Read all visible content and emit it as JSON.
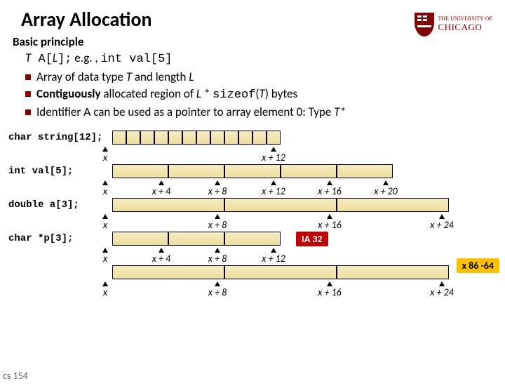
{
  "title": "Array Allocation",
  "logo": {
    "line1": "THE UNIVERSITY OF",
    "line2": "CHICAGO"
  },
  "content": {
    "subhead": "Basic principle",
    "decl_T": "T",
    "decl_code1": " A[",
    "decl_L": "L",
    "decl_code2": "];",
    "decl_eg": "  e.g. , ",
    "decl_eg_code": "int val[5]",
    "bullet1_a": "Array of data type ",
    "bullet1_T": "T",
    "bullet1_b": " and length ",
    "bullet1_L": "L",
    "bullet2_a": "Contiguously",
    "bullet2_b": " allocated region of ",
    "bullet2_L": "L",
    "bullet2_c": " * ",
    "bullet2_code": "sizeof",
    "bullet2_d": "(",
    "bullet2_T": "T",
    "bullet2_e": ") bytes",
    "bullet3_a": "Identifier ",
    "bullet3_code": "A",
    "bullet3_b": " can be used as a pointer to array element 0: Type ",
    "bullet3_T": "T*"
  },
  "diagrams": {
    "d1": {
      "label": "char string[12];",
      "ticks": [
        {
          "pos": 0,
          "text": "x"
        },
        {
          "pos": 240,
          "text": "x + 12"
        }
      ]
    },
    "d2": {
      "label": "int val[5];",
      "ticks": [
        {
          "pos": 0,
          "text": "x"
        },
        {
          "pos": 80,
          "text": "x + 4"
        },
        {
          "pos": 160,
          "text": "x + 8"
        },
        {
          "pos": 240,
          "text": "x + 12"
        },
        {
          "pos": 320,
          "text": "x + 16"
        },
        {
          "pos": 400,
          "text": "x + 20"
        }
      ]
    },
    "d3": {
      "label": "double a[3];",
      "ticks": [
        {
          "pos": 0,
          "text": "x"
        },
        {
          "pos": 160,
          "text": "x + 8"
        },
        {
          "pos": 320,
          "text": "x + 16"
        },
        {
          "pos": 480,
          "text": "x + 24"
        }
      ]
    },
    "d4": {
      "label": "char *p[3];",
      "ticks": [
        {
          "pos": 0,
          "text": "x"
        },
        {
          "pos": 80,
          "text": "x + 4"
        },
        {
          "pos": 160,
          "text": "x + 8"
        },
        {
          "pos": 240,
          "text": "x + 12"
        }
      ]
    },
    "d5": {
      "ticks": [
        {
          "pos": 0,
          "text": "x"
        },
        {
          "pos": 160,
          "text": "x + 8"
        },
        {
          "pos": 320,
          "text": "x + 16"
        },
        {
          "pos": 480,
          "text": "x + 24"
        }
      ]
    }
  },
  "badges": {
    "ia32": "IA 32",
    "x8664": "x 86 -64"
  },
  "footer": "cs 154",
  "chart_data": [
    {
      "type": "table",
      "title": "char string[12]",
      "element_bytes": 1,
      "count": 12,
      "addresses_labeled": [
        "x",
        "x+12"
      ]
    },
    {
      "type": "table",
      "title": "int val[5]",
      "element_bytes": 4,
      "count": 5,
      "addresses_labeled": [
        "x",
        "x+4",
        "x+8",
        "x+12",
        "x+16",
        "x+20"
      ]
    },
    {
      "type": "table",
      "title": "double a[3]",
      "element_bytes": 8,
      "count": 3,
      "addresses_labeled": [
        "x",
        "x+8",
        "x+16",
        "x+24"
      ]
    },
    {
      "type": "table",
      "title": "char *p[3] (IA32)",
      "element_bytes": 4,
      "count": 3,
      "addresses_labeled": [
        "x",
        "x+4",
        "x+8",
        "x+12"
      ]
    },
    {
      "type": "table",
      "title": "char *p[3] (x86-64)",
      "element_bytes": 8,
      "count": 3,
      "addresses_labeled": [
        "x",
        "x+8",
        "x+16",
        "x+24"
      ]
    }
  ]
}
